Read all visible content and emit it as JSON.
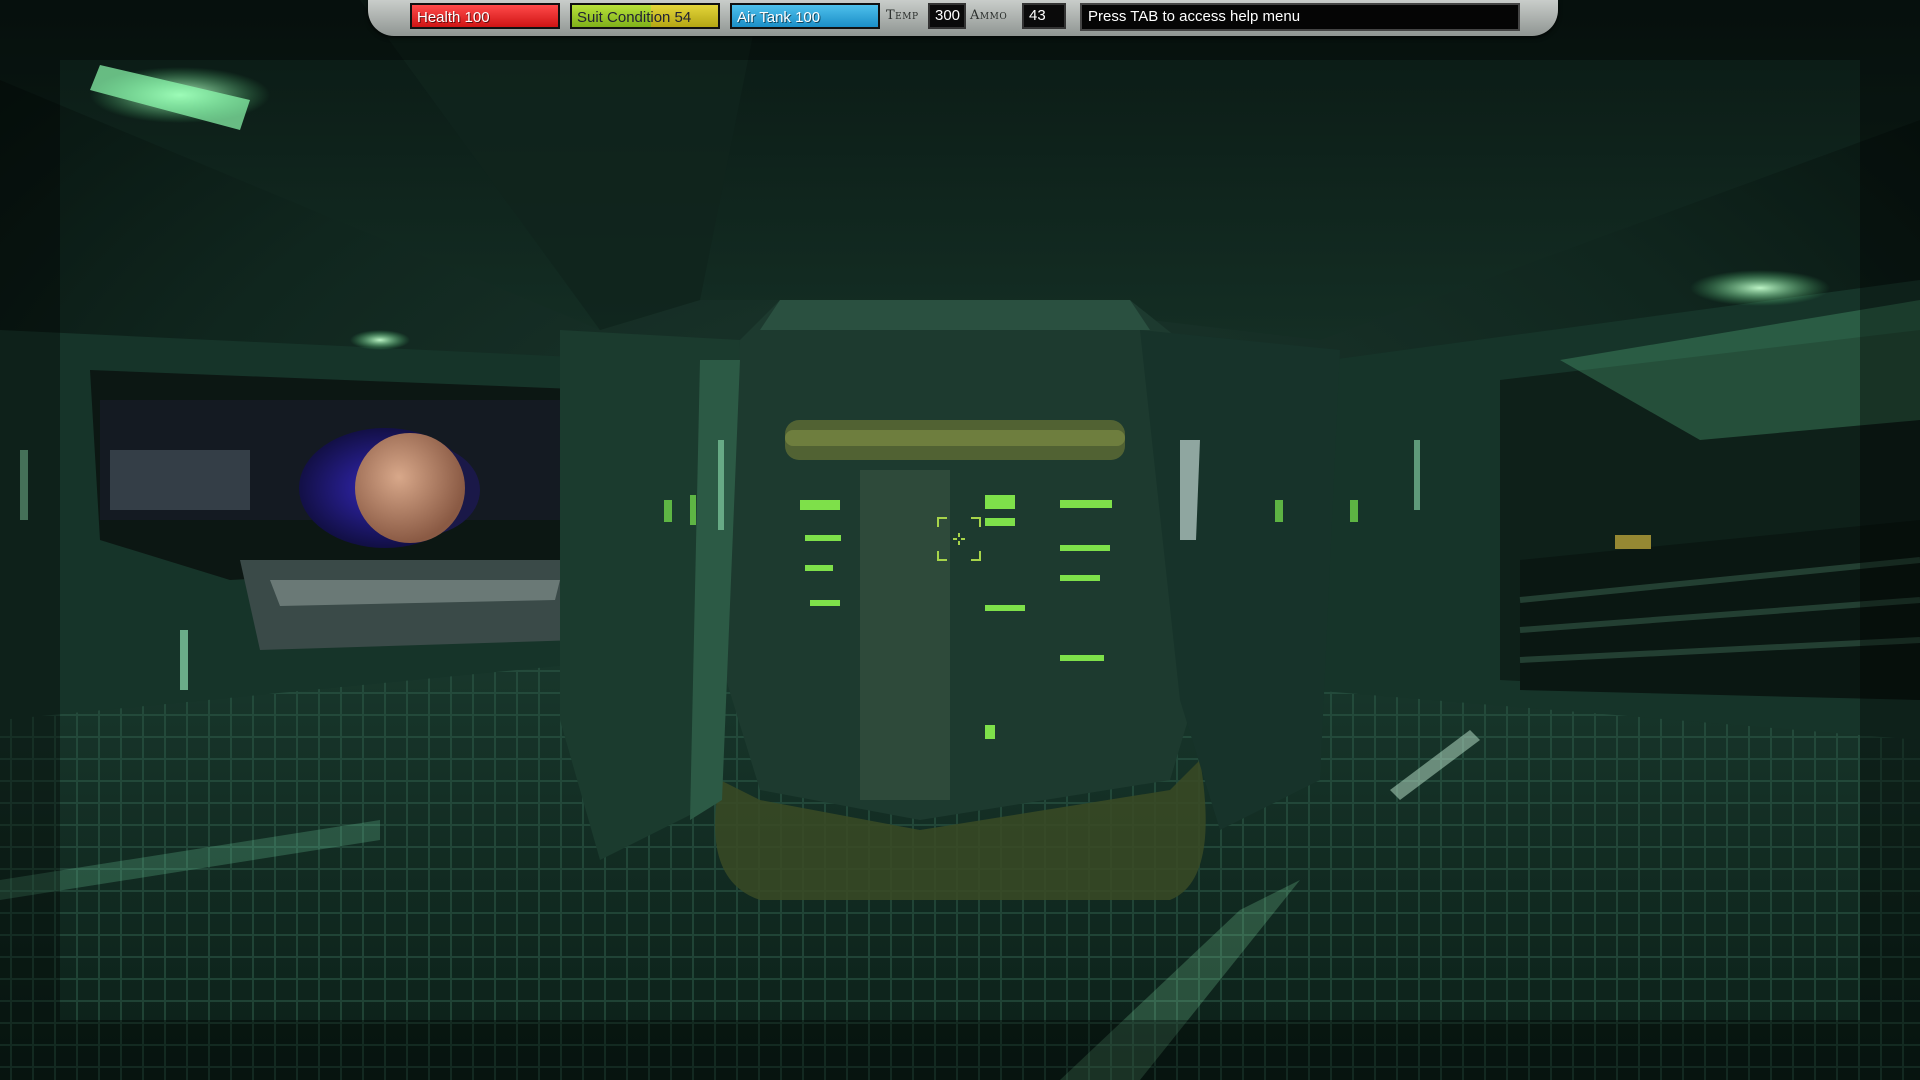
{
  "hud": {
    "health": {
      "label": "Health 100",
      "value": 100,
      "max": 100,
      "color": "#e02020"
    },
    "suit_condition": {
      "label": "Suit Condition 54",
      "value": 54,
      "max": 100,
      "color": "#8cc21f"
    },
    "air_tank": {
      "label": "Air Tank 100",
      "value": 100,
      "max": 100,
      "color": "#2aa4d8"
    },
    "temp": {
      "label": "Temp",
      "value": "300"
    },
    "ammo": {
      "label": "Ammo",
      "value": "43"
    },
    "help_message": "Press TAB to access help menu"
  },
  "crosshair": {
    "color": "#a7d44a",
    "icon": "crosshair-icon"
  },
  "scene": {
    "palette": {
      "base": "#0f2a22",
      "glow": "#6fe08a",
      "metal": "#234a3c"
    }
  }
}
